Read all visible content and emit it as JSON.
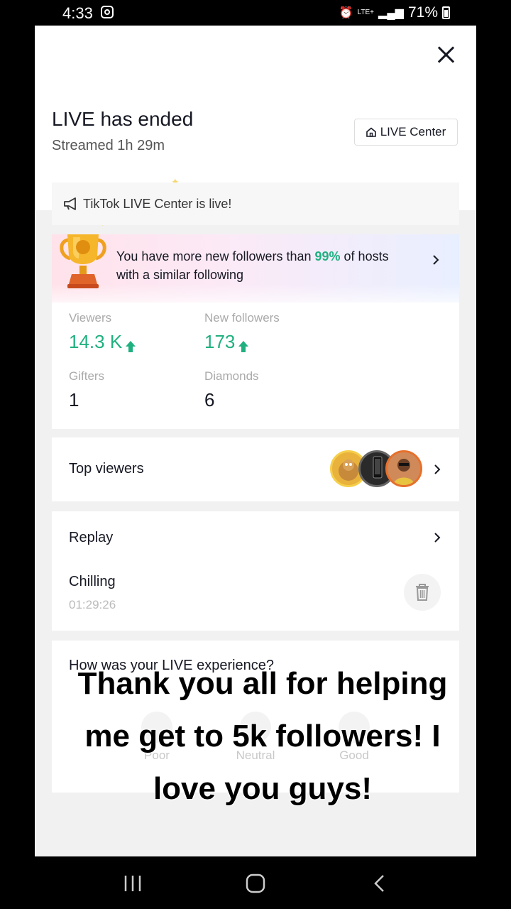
{
  "status_bar": {
    "time": "4:33",
    "network": "LTE+",
    "battery": "71%",
    "icons": [
      "instagram-icon",
      "alarm-icon",
      "signal-icon",
      "battery-icon"
    ]
  },
  "header": {
    "title": "LIVE has ended",
    "subtitle": "Streamed 1h 29m",
    "live_center_label": "LIVE Center"
  },
  "announcement": {
    "text": "TikTok LIVE Center is live!"
  },
  "promo": {
    "text_before": "You have more new followers than ",
    "percent": "99%",
    "text_after": " of hosts with a similar following"
  },
  "stats": {
    "viewers_label": "Viewers",
    "viewers_value": "14.3 K",
    "new_followers_label": "New followers",
    "new_followers_value": "173",
    "gifters_label": "Gifters",
    "gifters_value": "1",
    "diamonds_label": "Diamonds",
    "diamonds_value": "6"
  },
  "top_viewers": {
    "label": "Top viewers"
  },
  "replay": {
    "label": "Replay",
    "name": "Chilling",
    "duration": "01:29:26"
  },
  "experience": {
    "question": "How was your LIVE experience?",
    "options": [
      "Poor",
      "Neutral",
      "Good"
    ]
  },
  "caption": {
    "text": "Thank you all for helping me get to 5k followers! I love you guys!"
  },
  "colors": {
    "accent_green": "#20b080",
    "text_dark": "#161823"
  }
}
